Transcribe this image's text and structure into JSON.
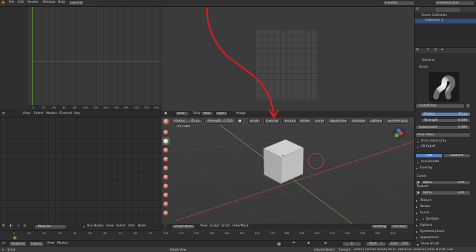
{
  "topbar": {
    "menus": [
      "File",
      "Edit",
      "Render",
      "Window",
      "Help"
    ],
    "workspace": "General",
    "scene": "Scene",
    "render_layer": "RenderLayer"
  },
  "outliner": {
    "items": [
      "Scene Collection",
      "Collection 1"
    ]
  },
  "timeline_graph": {
    "ticks": [
      "0",
      "20",
      "40",
      "60",
      "80",
      "100",
      "120",
      "140",
      "160",
      "180",
      "200",
      "220",
      "240"
    ],
    "menus": [
      "View",
      "Select",
      "Marker",
      "Channel",
      "Key"
    ]
  },
  "image_editor": {
    "menus": [
      "View",
      "Image"
    ],
    "view": "View",
    "new_label": "New",
    "open_label": "Open"
  },
  "viewport": {
    "header": {
      "radius_label": "Radius:",
      "radius_value": "35 px",
      "strength_label": "Strength",
      "strength_value": "0.500",
      "menus": [
        "Brush",
        "Overlay",
        "Texture",
        "Stroke",
        "Curve",
        "Appearance",
        "Dyntopo",
        "Options",
        "Symmetry/Lock"
      ]
    },
    "object_label": "(0) Cube",
    "mode": "Sculpt Mode",
    "bottom_menus": [
      "View",
      "Sculpt",
      "Brush",
      "Hide/Mask"
    ],
    "shading": "Shading",
    "overlays": "Overlays"
  },
  "node_editor": {
    "material": "Material",
    "use_nodes": "Use Nodes",
    "menus": [
      "View",
      "Select",
      "Add",
      "Node"
    ]
  },
  "properties": {
    "tab": "General",
    "brush_section": "Brush",
    "brush_name": "SculptDraw",
    "radius_label": "Radius",
    "radius_value": "35 px",
    "strength_label": "Strength",
    "strength_value": "0.500",
    "autosmooth_label": "Autosmooth",
    "autosmooth_value": "0.000",
    "area_plane": "Area Plane",
    "front_faces": "Front Faces Only",
    "falloff_2d": "2D Falloff",
    "add": "Add",
    "subtract": "Subtract",
    "accumulate": "Accumulate",
    "overlay_section": "Overlay",
    "curve_label": "Curve:",
    "texture_label": "Texture:",
    "alpha": "Alpha",
    "curve_pct": "33%",
    "texture_pct": "33%",
    "sections_closed": [
      "Texture",
      "Stroke",
      "Curve",
      "Dyntopo",
      "Options",
      "Symmetry/Lock"
    ],
    "appearance": "Appearance",
    "show_brush": "Show Brush"
  },
  "timeline": {
    "ticks": [
      "0",
      "10",
      "20",
      "30",
      "40",
      "50",
      "60",
      "70",
      "80",
      "90",
      "100",
      "110",
      "120",
      "130",
      "140",
      "150",
      "160",
      "170",
      "180",
      "190",
      "200",
      "210",
      "220",
      "230",
      "240",
      "250"
    ],
    "menus": [
      "Playback",
      "Keying",
      "View",
      "Marker"
    ],
    "current_frame": "0",
    "start_label": "Start:",
    "start_value": "1",
    "end_label": "End:",
    "end_value": "250"
  },
  "statusbar": {
    "left": "Scroll",
    "center": "Rotate View",
    "right_a": "Activate/Select",
    "right_b": "Translate",
    "stats": "v2.80.19 | Verts:8 | Faces:6 | Tris:12 | Objects:1/3 | Lamps:0/1 | Mem: 14.8 MB | Cube"
  },
  "colors": {
    "accent_blue": "#5680c2",
    "annotation_red": "#e01b1b",
    "x_axis": "#b84848",
    "y_axis": "#6aa84f"
  }
}
